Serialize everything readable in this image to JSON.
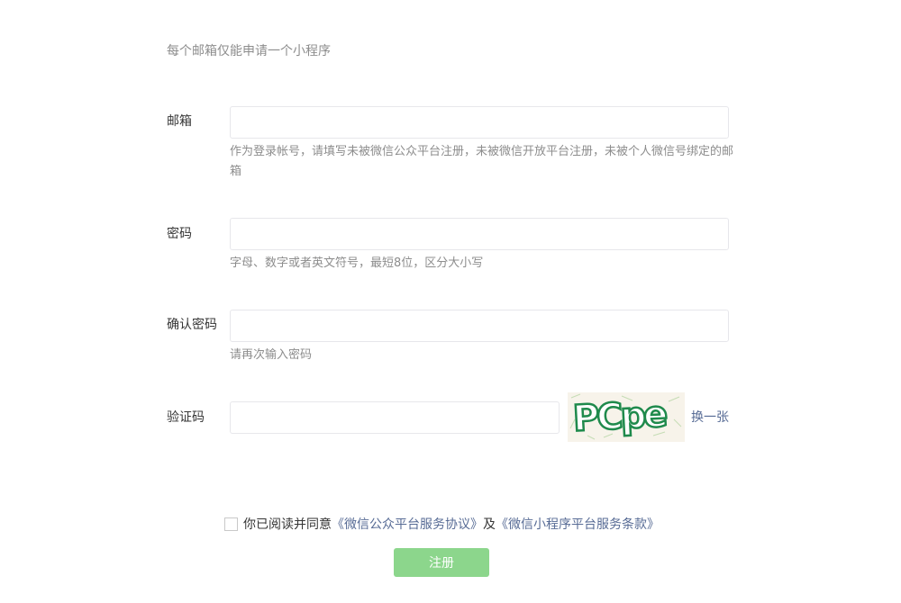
{
  "intro": "每个邮箱仅能申请一个小程序",
  "fields": {
    "email": {
      "label": "邮箱",
      "value": "",
      "tip": "作为登录帐号，请填写未被微信公众平台注册，未被微信开放平台注册，未被个人微信号绑定的邮箱"
    },
    "password": {
      "label": "密码",
      "value": "",
      "tip": "字母、数字或者英文符号，最短8位，区分大小写"
    },
    "confirm_password": {
      "label": "确认密码",
      "value": "",
      "tip": "请再次输入密码"
    },
    "captcha": {
      "label": "验证码",
      "value": "",
      "image_text": "PCpe",
      "refresh_label": "换一张"
    }
  },
  "agreement": {
    "checked": false,
    "prefix": "你已阅读并同意",
    "link1": "《微信公众平台服务协议》",
    "middle": "及",
    "link2": "《微信小程序平台服务条款》"
  },
  "submit_label": "注册",
  "colors": {
    "link": "#576b95",
    "submit_bg": "#8cd68c",
    "captcha_text": "#1f8a4c"
  }
}
